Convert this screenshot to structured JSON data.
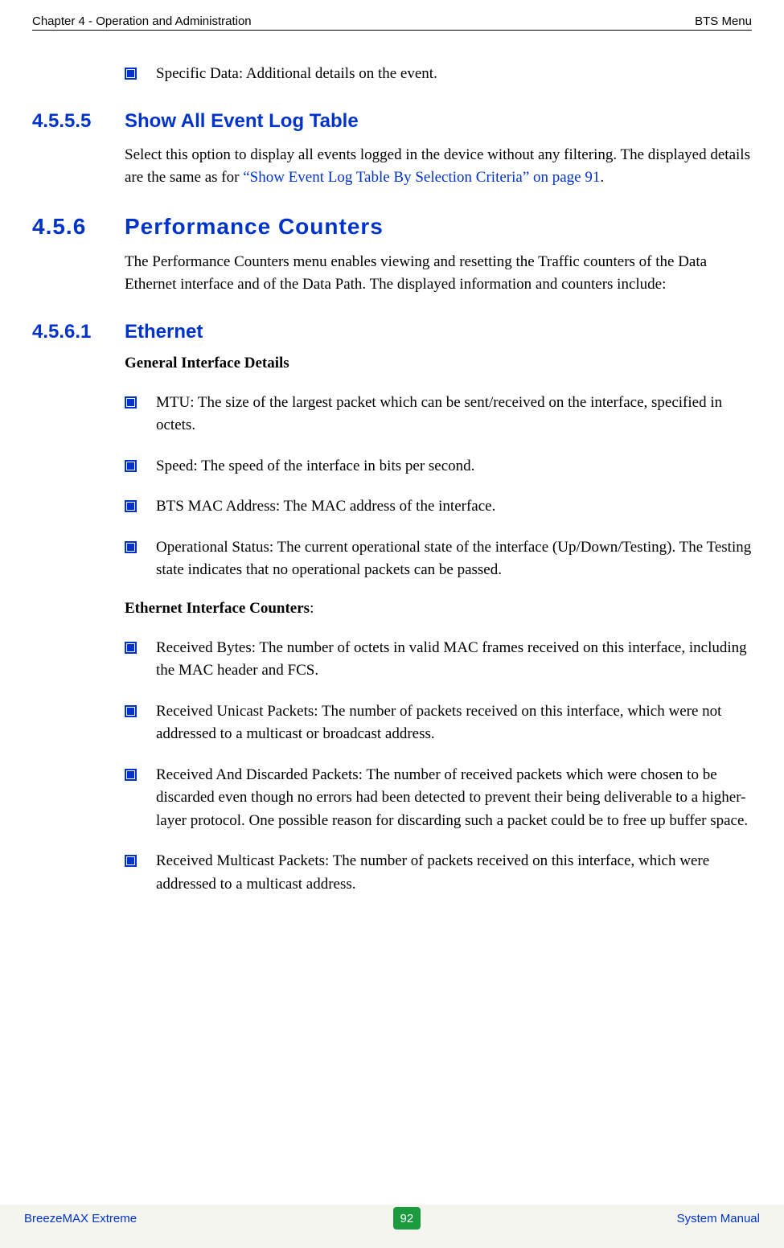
{
  "header": {
    "left": "Chapter 4 - Operation and Administration",
    "right": "BTS Menu"
  },
  "bullets_top": [
    "Specific Data: Additional details on the event."
  ],
  "sec_4555": {
    "num": "4.5.5.5",
    "title": "Show All Event Log Table",
    "para_part1": "Select this option to display all events logged in the device without any filtering. The displayed details are the same as for ",
    "para_link": "“Show Event Log Table By Selection Criteria” on page 91",
    "para_part2": "."
  },
  "sec_456": {
    "num": "4.5.6",
    "title": "Performance Counters",
    "para": "The Performance Counters menu enables viewing and resetting the Traffic counters of the Data Ethernet interface and of the Data Path. The displayed information and counters include:"
  },
  "sec_4561": {
    "num": "4.5.6.1",
    "title": "Ethernet",
    "sub1": "General Interface Details",
    "bullets1": [
      "MTU: The size of the largest packet which can be sent/received on the interface, specified in octets.",
      "Speed: The speed of the interface in bits per second.",
      "BTS MAC Address: The MAC address of the interface.",
      "Operational Status: The current operational state of the interface (Up/Down/Testing). The Testing state indicates that no operational packets can be passed."
    ],
    "sub2_bold": "Ethernet Interface Counters",
    "sub2_colon": ":",
    "bullets2": [
      "Received Bytes: The number of octets in valid MAC frames received on this interface, including the MAC header and FCS.",
      "Received Unicast Packets: The number of packets received on this interface, which were not addressed to a multicast or broadcast address.",
      "Received And Discarded Packets: The number of received packets which were chosen to be discarded even though no errors had been detected to prevent their being deliverable to a higher-layer protocol. One possible reason for discarding such a packet could be to free up buffer space.",
      "Received Multicast Packets: The number of packets received on this interface, which were addressed to a multicast address."
    ]
  },
  "footer": {
    "left": "BreezeMAX Extreme",
    "page": "92",
    "right": "System Manual"
  }
}
